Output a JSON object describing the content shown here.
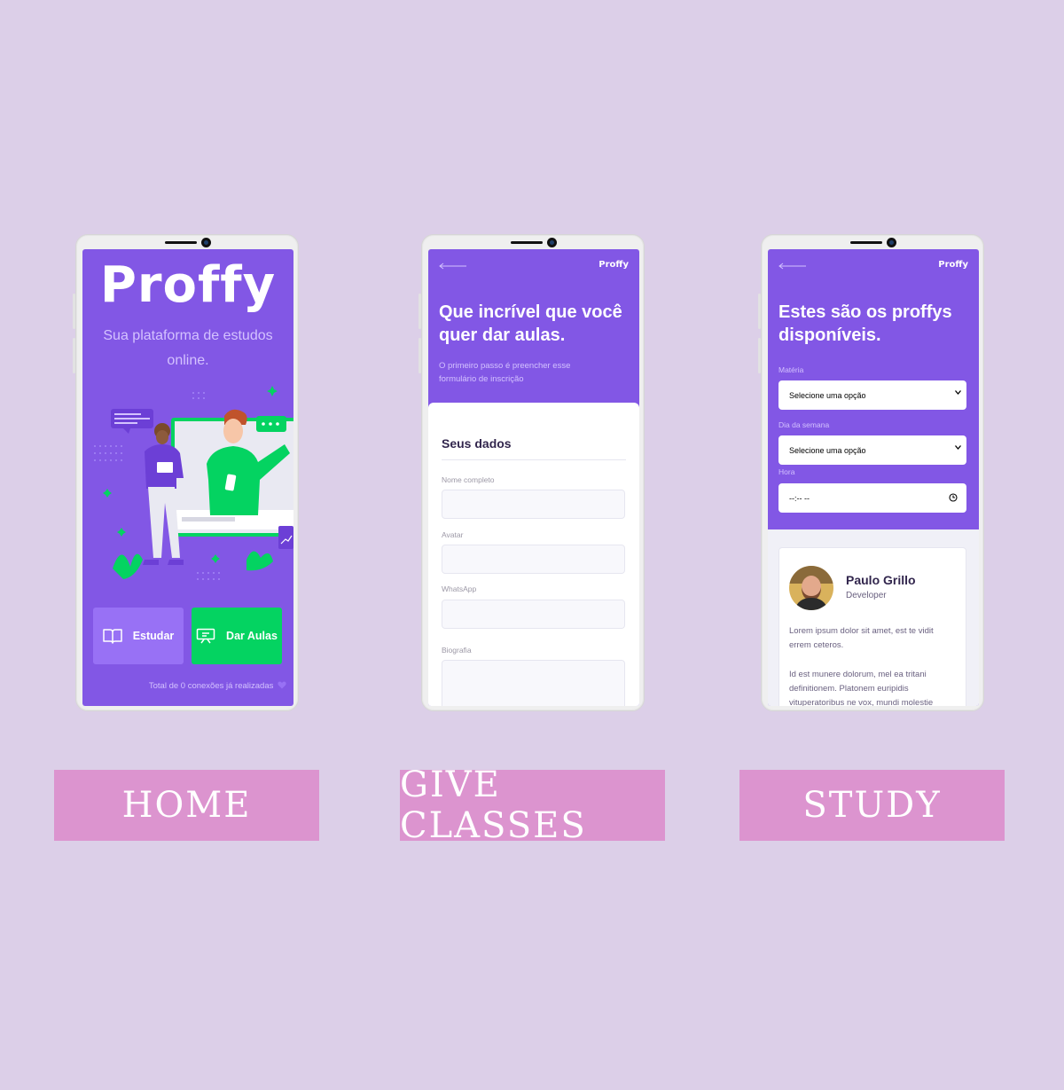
{
  "colors": {
    "background": "#dccfe8",
    "primary": "#8257e5",
    "primary_light": "#9871f5",
    "secondary": "#04d361",
    "caption_bg": "#dc94cf"
  },
  "home": {
    "logo": "Proffy",
    "tagline": "Sua plataforma de estudos online.",
    "study_button": "Estudar",
    "give_classes_button": "Dar Aulas",
    "total_connections": "Total de 0 conexões já realizadas",
    "icons": [
      "book-open-icon",
      "presentation-icon",
      "heart-icon"
    ]
  },
  "give_classes": {
    "header_logo": "Proffy",
    "title": "Que incrível que você quer dar aulas.",
    "subtitle": "O primeiro passo é preencher esse formulário de inscrição",
    "section_title": "Seus dados",
    "fields": [
      {
        "label": "Nome completo"
      },
      {
        "label": "Avatar"
      },
      {
        "label": "WhatsApp"
      },
      {
        "label": "Biografia"
      }
    ]
  },
  "study": {
    "header_logo": "Proffy",
    "title": "Estes são os proffys disponíveis.",
    "filters": {
      "subject_label": "Matéria",
      "subject_value": "Selecione uma opção",
      "weekday_label": "Dia da semana",
      "weekday_value": "Selecione uma opção",
      "time_label": "Hora",
      "time_value": "--:-- --"
    },
    "teacher": {
      "name": "Paulo Grillo",
      "role": "Developer",
      "bio_1": "Lorem ipsum dolor sit amet, est te vidit errem ceteros.",
      "bio_2": "Id est munere dolorum, mel ea tritani definitionem. Platonem euripidis vituperatoribus ne vox, mundi molestie"
    }
  },
  "captions": {
    "home": "HOME",
    "give_classes": "GIVE CLASSES",
    "study": "STUDY"
  }
}
